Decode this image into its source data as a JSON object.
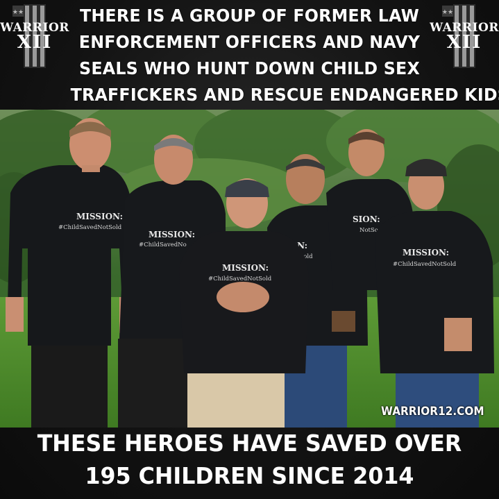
{
  "headline": {
    "lines": [
      "THERE IS A GROUP OF FORMER LAW",
      "ENFORCEMENT OFFICERS AND NAVY",
      "SEALS WHO HUNT DOWN CHILD SEX",
      "TRAFFICKERS AND RESCUE ENDANGERED KIDS"
    ]
  },
  "logo": {
    "word": "WARRIOR",
    "numeral": "XII"
  },
  "photo": {
    "shirt_title": "MISSION:",
    "shirt_hashtag": "#ChildSavedNotSold",
    "shirt_hashtag_partial": "#ChildSavedNo",
    "shirt_title_partial_a": "SION:",
    "shirt_hashtag_partial_a": "NotSo",
    "shirt_title_partial_b": "ION:",
    "shirt_hashtag_partial_b": "tSold"
  },
  "watermark": "WARRIOR12.COM",
  "caption": {
    "lines": [
      "THESE HEROES HAVE SAVED OVER",
      "195 CHILDREN SINCE 2014"
    ]
  },
  "colors": {
    "background": "#111111",
    "text": "#ffffff",
    "foliage": "#3f6b2f",
    "grass": "#4f8a2e",
    "shirt": "#17191c"
  }
}
